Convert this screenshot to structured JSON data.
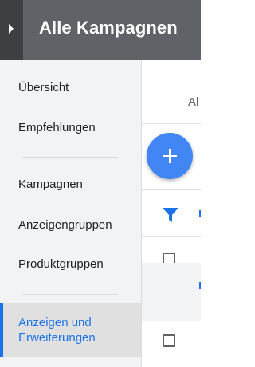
{
  "header": {
    "title": "Alle Kampagnen",
    "toggle_icon": "chevron-right-icon"
  },
  "sidebar": {
    "items": [
      {
        "label": "Übersicht"
      },
      {
        "label": "Empfehlungen"
      },
      {
        "label": "Kampagnen"
      },
      {
        "label": "Anzeigengruppen"
      },
      {
        "label": "Produktgruppen"
      }
    ],
    "active_item": {
      "label_line1": "Anzeigen und",
      "label_line2": "Erweiterungen"
    }
  },
  "main": {
    "tab_label": "Al",
    "fab_icon": "plus-icon",
    "filter_icon": "filter-icon"
  },
  "colors": {
    "accent": "#1a73e8",
    "fab": "#4285f4",
    "topbar": "#5f6368",
    "sidebar_bg": "#f1f3f4"
  }
}
